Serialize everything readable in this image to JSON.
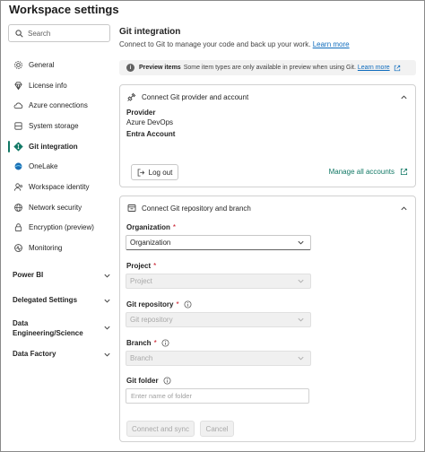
{
  "page": {
    "title": "Workspace settings"
  },
  "search": {
    "placeholder": "Search"
  },
  "sidebar": {
    "items": [
      {
        "label": "General",
        "icon": "gear-icon"
      },
      {
        "label": "License info",
        "icon": "diamond-icon"
      },
      {
        "label": "Azure connections",
        "icon": "cloud-icon"
      },
      {
        "label": "System storage",
        "icon": "storage-icon"
      },
      {
        "label": "Git integration",
        "icon": "git-icon",
        "active": true
      },
      {
        "label": "OneLake",
        "icon": "onelake-icon"
      },
      {
        "label": "Workspace identity",
        "icon": "identity-icon"
      },
      {
        "label": "Network security",
        "icon": "network-icon"
      },
      {
        "label": "Encryption (preview)",
        "icon": "lock-icon"
      },
      {
        "label": "Monitoring",
        "icon": "monitoring-icon"
      }
    ],
    "groups": [
      {
        "line1": "Power BI",
        "line2": ""
      },
      {
        "line1": "Delegated Settings",
        "line2": ""
      },
      {
        "line1": "Data",
        "line2": "Engineering/Science"
      },
      {
        "line1": "Data Factory",
        "line2": ""
      }
    ]
  },
  "main": {
    "title": "Git integration",
    "description": "Connect to Git to manage your code and back up your work.",
    "learn_more": "Learn more",
    "preview": {
      "label": "Preview items",
      "text": "Some item types are only available in preview when using Git.",
      "link": "Learn more"
    },
    "provider_card": {
      "title": "Connect Git provider and account",
      "provider_label": "Provider",
      "provider_value": "Azure DevOps",
      "account_label": "Entra Account",
      "logout": "Log out",
      "manage": "Manage all accounts"
    },
    "repo_card": {
      "title": "Connect Git repository and branch",
      "organization_label": "Organization",
      "organization_value": "Organization",
      "project_label": "Project",
      "project_placeholder": "Project",
      "repository_label": "Git repository",
      "repository_placeholder": "Git repository",
      "branch_label": "Branch",
      "branch_placeholder": "Branch",
      "folder_label": "Git folder",
      "folder_placeholder": "Enter name of folder",
      "connect": "Connect and sync",
      "cancel": "Cancel",
      "required_mark": "*"
    }
  },
  "colors": {
    "accent": "#117865",
    "link": "#0f6cbd",
    "required": "#c50f1f"
  }
}
